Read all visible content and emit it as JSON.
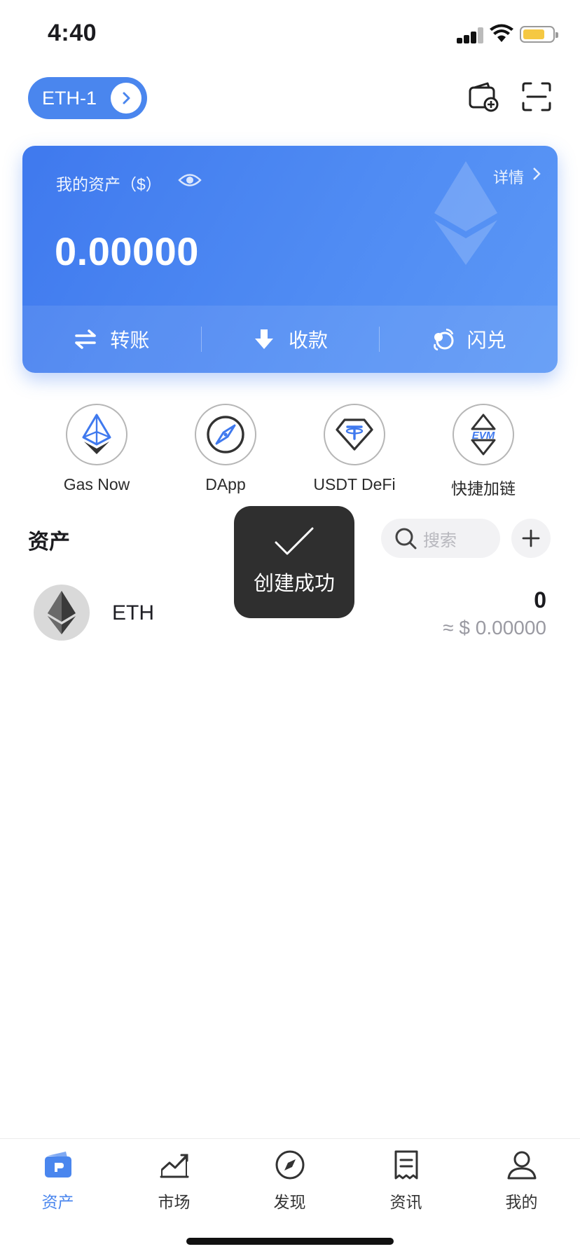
{
  "status_bar": {
    "time": "4:40"
  },
  "header": {
    "wallet_name": "ETH-1",
    "icons": [
      "wallet-add-icon",
      "scan-icon"
    ]
  },
  "asset_card": {
    "label": "我的资产（$）",
    "details": "详情",
    "balance": "0.00000",
    "actions": [
      {
        "label": "转账",
        "icon": "transfer-icon"
      },
      {
        "label": "收款",
        "icon": "receive-icon"
      },
      {
        "label": "闪兑",
        "icon": "swap-icon"
      }
    ]
  },
  "quick_entries": [
    {
      "label": "Gas Now",
      "icon": "gas-eth-icon"
    },
    {
      "label": "DApp",
      "icon": "compass-icon"
    },
    {
      "label": "USDT DeFi",
      "icon": "tether-icon"
    },
    {
      "label": "快捷加链",
      "icon": "evm-icon"
    }
  ],
  "assets_section": {
    "title": "资产",
    "search_placeholder": "搜索",
    "items": [
      {
        "name": "ETH",
        "amount": "0",
        "value": "≈ $ 0.00000"
      }
    ]
  },
  "toast": {
    "text": "创建成功"
  },
  "tab_bar": {
    "active": 0,
    "tabs": [
      {
        "label": "资产",
        "icon": "wallet-icon"
      },
      {
        "label": "市场",
        "icon": "market-chart-icon"
      },
      {
        "label": "发现",
        "icon": "discover-compass-icon"
      },
      {
        "label": "资讯",
        "icon": "news-icon"
      },
      {
        "label": "我的",
        "icon": "profile-icon"
      }
    ]
  },
  "colors": {
    "accent": "#4a86ee",
    "toast_bg": "#2f2f2f",
    "battery": "#f5c842"
  }
}
